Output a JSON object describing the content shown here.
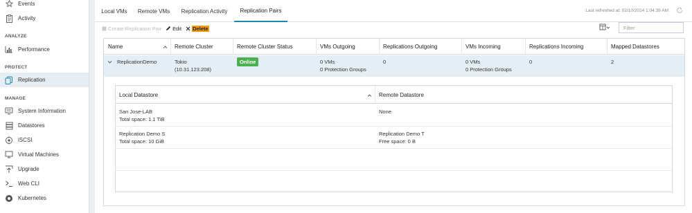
{
  "sidebar": {
    "items_top": [
      {
        "label": "Events",
        "icon": "star-icon"
      },
      {
        "label": "Activity",
        "icon": "clipboard-icon"
      }
    ],
    "sections": [
      {
        "title": "ANALYZE",
        "items": [
          {
            "label": "Performance",
            "icon": "bar-chart-icon"
          }
        ]
      },
      {
        "title": "PROTECT",
        "items": [
          {
            "label": "Replication",
            "icon": "copy-icon",
            "active": true
          }
        ]
      },
      {
        "title": "MANAGE",
        "items": [
          {
            "label": "System Information",
            "icon": "monitor-list-icon"
          },
          {
            "label": "Datastores",
            "icon": "database-icon"
          },
          {
            "label": "iSCSI",
            "icon": "iscsi-icon"
          },
          {
            "label": "Virtual Machines",
            "icon": "monitor-icon"
          },
          {
            "label": "Upgrade",
            "icon": "upgrade-icon"
          },
          {
            "label": "Web CLI",
            "icon": "terminal-icon"
          },
          {
            "label": "Kubernetes",
            "icon": "kubernetes-icon"
          }
        ]
      }
    ]
  },
  "tabs": [
    {
      "label": "Local VMs"
    },
    {
      "label": "Remote VMs"
    },
    {
      "label": "Replication Activity"
    },
    {
      "label": "Replication Pairs",
      "active": true
    }
  ],
  "refresh": {
    "label": "Last refreshed at: 02/10/2024 1:04:39 AM"
  },
  "toolbar": {
    "create_label": "Create Replication Pair",
    "edit_label": "Edit",
    "delete_label": "Delete"
  },
  "filter": {
    "placeholder": "Filter",
    "value": ""
  },
  "grid": {
    "columns": [
      "Name",
      "Remote Cluster",
      "Remote Cluster Status",
      "VMs Outgoing",
      "Replications Outgoing",
      "VMs Incoming",
      "Replications Incoming",
      "Mapped Datastores"
    ],
    "row": {
      "name": "ReplicationDemo",
      "remote_cluster": "Tokio",
      "remote_cluster_ip": "(10.31.123.208)",
      "status": "Online",
      "vms_outgoing": "0 VMs",
      "vms_outgoing_groups": "0 Protection Groups",
      "replications_outgoing": "0",
      "vms_incoming": "0 VMs",
      "vms_incoming_groups": "0 Protection Groups",
      "replications_incoming": "0",
      "mapped_datastores": "2"
    }
  },
  "detail": {
    "columns": [
      "Local Datastore",
      "Remote Datastore"
    ],
    "rows": [
      {
        "local_name": "San Jose-LAB",
        "local_space": "Total space: 1.1 TiB",
        "remote_name": "None",
        "remote_space": ""
      },
      {
        "local_name": "Replication Demo S",
        "local_space": "Total space: 10 GiB",
        "remote_name": "Replication Demo T",
        "remote_space": "Free space: 0 B"
      }
    ]
  },
  "colors": {
    "accent": "#1a8cb0",
    "online": "#4caf50",
    "delete_highlight": "#f39c12",
    "selected_row": "#e3eef6"
  }
}
